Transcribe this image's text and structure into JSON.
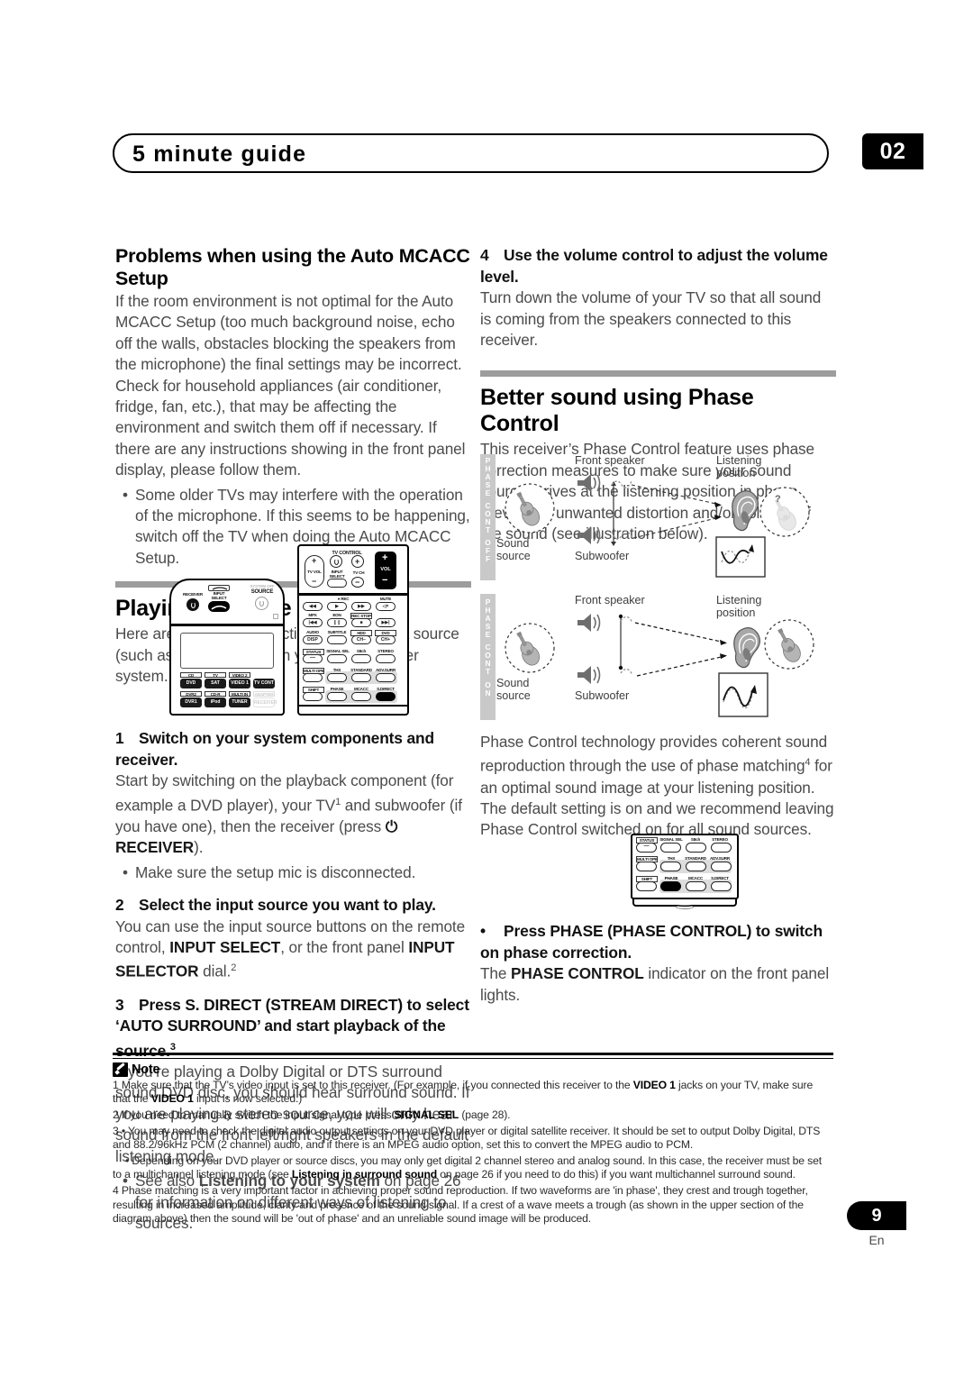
{
  "header": {
    "title": "5 minute guide",
    "chapter": "02"
  },
  "left_column": {
    "section1_heading": "Problems when using the Auto MCACC Setup",
    "section1_body": "If the room environment is not optimal for the Auto MCACC Setup (too much background noise, echo off the walls, obstacles blocking the speakers from the microphone) the final settings may be incorrect. Check for household appliances (air conditioner, fridge, fan, etc.), that may be affecting the environment and switch them off if necessary. If there are any instructions showing in the front panel display, please follow them.",
    "section1_bullets": [
      "Some older TVs may interfere with the operation of the microphone. If this seems to be happening, switch off the TV when doing the Auto MCACC Setup."
    ],
    "section2_heading": "Playing a source",
    "section2_body": "Here are the basic instructions for playing a source (such as a DVD disc) with your home theater system.",
    "steps": [
      {
        "num": "1",
        "heading": "Switch on your system components and receiver.",
        "body_pre": "Start by switching on the playback component (for example a DVD player), your TV",
        "sup": "1",
        "body_mid": " and subwoofer (if you have one), then the receiver (press ",
        "power_glyph": "⏻",
        "bold_word": "RECEIVER",
        "body_post": ").",
        "bullets": [
          "Make sure the setup mic is disconnected."
        ]
      },
      {
        "num": "2",
        "heading": "Select the input source you want to play.",
        "body_pre": "You can use the input source buttons on the remote control, ",
        "bold1": "INPUT SELECT",
        "body_mid": ", or the front panel ",
        "bold2": "INPUT SELECTOR",
        "body_post": " dial.",
        "sup": "2"
      },
      {
        "num": "3",
        "heading": "Press S. DIRECT (STREAM DIRECT) to select ‘AUTO SURROUND’ and start playback of the source.",
        "sup": "3",
        "body": "If you’re playing a Dolby Digital or DTS surround sound DVD disc, you should hear surround sound. If you are playing a stereo source, you will only hear sound from the front left/right speakers in the default listening mode.",
        "bullet_pre": "See also ",
        "bullet_bold": "Listening to your system",
        "bullet_post": " on page 26 for information on different ways of listening to sources."
      }
    ]
  },
  "right_column": {
    "step4": {
      "num": "4",
      "heading": "Use the volume control to adjust the volume level.",
      "body": "Turn down the volume of your TV so that all sound is coming from the speakers connected to this receiver."
    },
    "section_heading": "Better sound using Phase Control",
    "section_body": "This receiver’s Phase Control feature uses phase correction measures to make sure your sound source arrives at the listening position in phase, preventing unwanted distortion and/or coloring of the sound (see illustration below).",
    "phase_body_pre": "Phase Control technology provides coherent sound reproduction through the use of phase matching",
    "phase_body_sup": "4",
    "phase_body_post": " for an optimal sound image at your listening position. The default setting is on and we recommend leaving Phase Control switched on for all sound sources.",
    "phase_bullet_bold": "Press PHASE (PHASE CONTROL) to switch on phase correction.",
    "phase_bullet_pre": "The ",
    "phase_bullet_bold2": "PHASE CONTROL",
    "phase_bullet_post": " indicator on the front panel lights."
  },
  "diagrams": [
    {
      "id": "phase-control-off",
      "sidebar_text": "PHASE CONT OFF",
      "sidebar_chars": [
        "P",
        "H",
        "A",
        "S",
        "E",
        "C",
        "O",
        "N",
        "T",
        "O",
        "F",
        "F"
      ],
      "labels": {
        "front_speaker": "Front speaker",
        "listening_position_l1": "Listening",
        "listening_position_l2": "position",
        "sound_source_l1": "Sound",
        "sound_source_l2": "source",
        "subwoofer": "Subwoofer",
        "question_mark": "?"
      }
    },
    {
      "id": "phase-control-on",
      "sidebar_text": "PHASE CONT ON",
      "sidebar_chars": [
        "P",
        "H",
        "A",
        "S",
        "E",
        "C",
        "O",
        "N",
        "T",
        "O",
        "N"
      ],
      "labels": {
        "front_speaker": "Front speaker",
        "listening_position_l1": "Listening",
        "listening_position_l2": "position",
        "sound_source_l1": "Sound",
        "sound_source_l2": "source",
        "subwoofer": "Subwoofer"
      }
    }
  ],
  "remote": {
    "top_labels": {
      "receiver": "RECEIVER",
      "input_select_l1": "INPUT",
      "input_select_l2": "SELECT",
      "system_off": "SYSTEM OFF",
      "source": "SOURCE"
    },
    "source_buttons": [
      {
        "top": "CD",
        "main": "DVD"
      },
      {
        "top": "TV",
        "main": "SAT"
      },
      {
        "top": "VIDEO 2",
        "main": "VIDEO 1"
      },
      {
        "top": "",
        "main": "TV CONT"
      },
      {
        "top": "DVR2",
        "main": "DVR1"
      },
      {
        "top": "CD-R",
        "main": "iPod"
      },
      {
        "top": "MULTI IN",
        "main": "TUNER"
      },
      {
        "top": "ADAPTER",
        "main": "RECEIVER"
      }
    ],
    "right_panel": {
      "tv_control": "TV CONTROL",
      "tv_vol": "TV VOL",
      "input_select_l1": "INPUT",
      "input_select_l2": "SELECT",
      "tv_ch": "TV CH",
      "vol": "VOL",
      "rec": "REC",
      "mute": "MUTE",
      "mpx": "MPX",
      "eon": "EON",
      "rec_stop": "REC STOP",
      "audio": "AUDIO",
      "subtitle": "SUBTITLE",
      "hdd": "HDD",
      "dvd": "DVD",
      "disp": "DISP",
      "ch_minus": "CH−",
      "ch_plus": "CH+",
      "status": "STATUS",
      "signal_sel": "SIGNAL SEL",
      "s8ch": "S8ch",
      "stereo": "STEREO",
      "multi_ope": "MULTI OPE",
      "thx": "THX",
      "standard": "STANDARD",
      "adv_surr": "ADV.SURR",
      "shift": "SHIFT",
      "phase": "PHASE",
      "mcacc": "MCACC",
      "s_direct": "S.DIRECT"
    }
  },
  "footnotes": {
    "note_title": "Note",
    "items": [
      {
        "num": "1",
        "parts": [
          {
            "t": "Make sure that the TV’s video input is set to this receiver. (For example, if you connected this receiver to the ",
            "b": false
          },
          {
            "t": "VIDEO 1",
            "b": true
          },
          {
            "t": " jacks on your TV, make sure that the ",
            "b": false
          },
          {
            "t": "VIDEO 1",
            "b": true
          },
          {
            "t": " input is now selected.)",
            "b": false
          }
        ]
      },
      {
        "num": "2",
        "parts": [
          {
            "t": "If you need to manually switch the input signal type press ",
            "b": false
          },
          {
            "t": "SIGNAL SEL",
            "b": true
          },
          {
            "t": " (page 28).",
            "b": false
          }
        ]
      },
      {
        "num": "3",
        "parts": [
          {
            "t": "• You may need to check the digital audio output settings on your DVD player or digital satellite receiver. It should be set to output Dolby Digital, DTS and 88.2/96kHz PCM (2 channel) audio, and if there is an MPEG audio option, set this to convert the MPEG audio to PCM.",
            "b": false
          }
        ]
      },
      {
        "num": "",
        "indent": true,
        "parts": [
          {
            "t": "• Depending on your DVD player or source discs, you may only get digital 2 channel stereo and analog sound. In this case, the receiver must be set to a multichannel listening mode (see ",
            "b": false
          },
          {
            "t": "Listening in surround sound",
            "b": true
          },
          {
            "t": " on page 26 if you need to do this) if you want multichannel surround sound.",
            "b": false
          }
        ]
      },
      {
        "num": "4",
        "parts": [
          {
            "t": "Phase matching is a very important factor in achieving proper sound reproduction. If two waveforms are 'in phase', they crest and trough together, resulting in increased amplitude, clarity and presence of the sound signal. If a crest of a wave meets a trough (as shown in the upper section of the diagram above) then the sound will be 'out of phase' and an unreliable sound image will be produced.",
            "b": false
          }
        ]
      }
    ]
  },
  "page_footer": {
    "number": "9",
    "language": "En"
  },
  "colors": {
    "rule_gray": "#9d9d9d",
    "body_text": "#4b4b4b",
    "black": "#000000",
    "diagram_gray": "#c9c9c9"
  }
}
